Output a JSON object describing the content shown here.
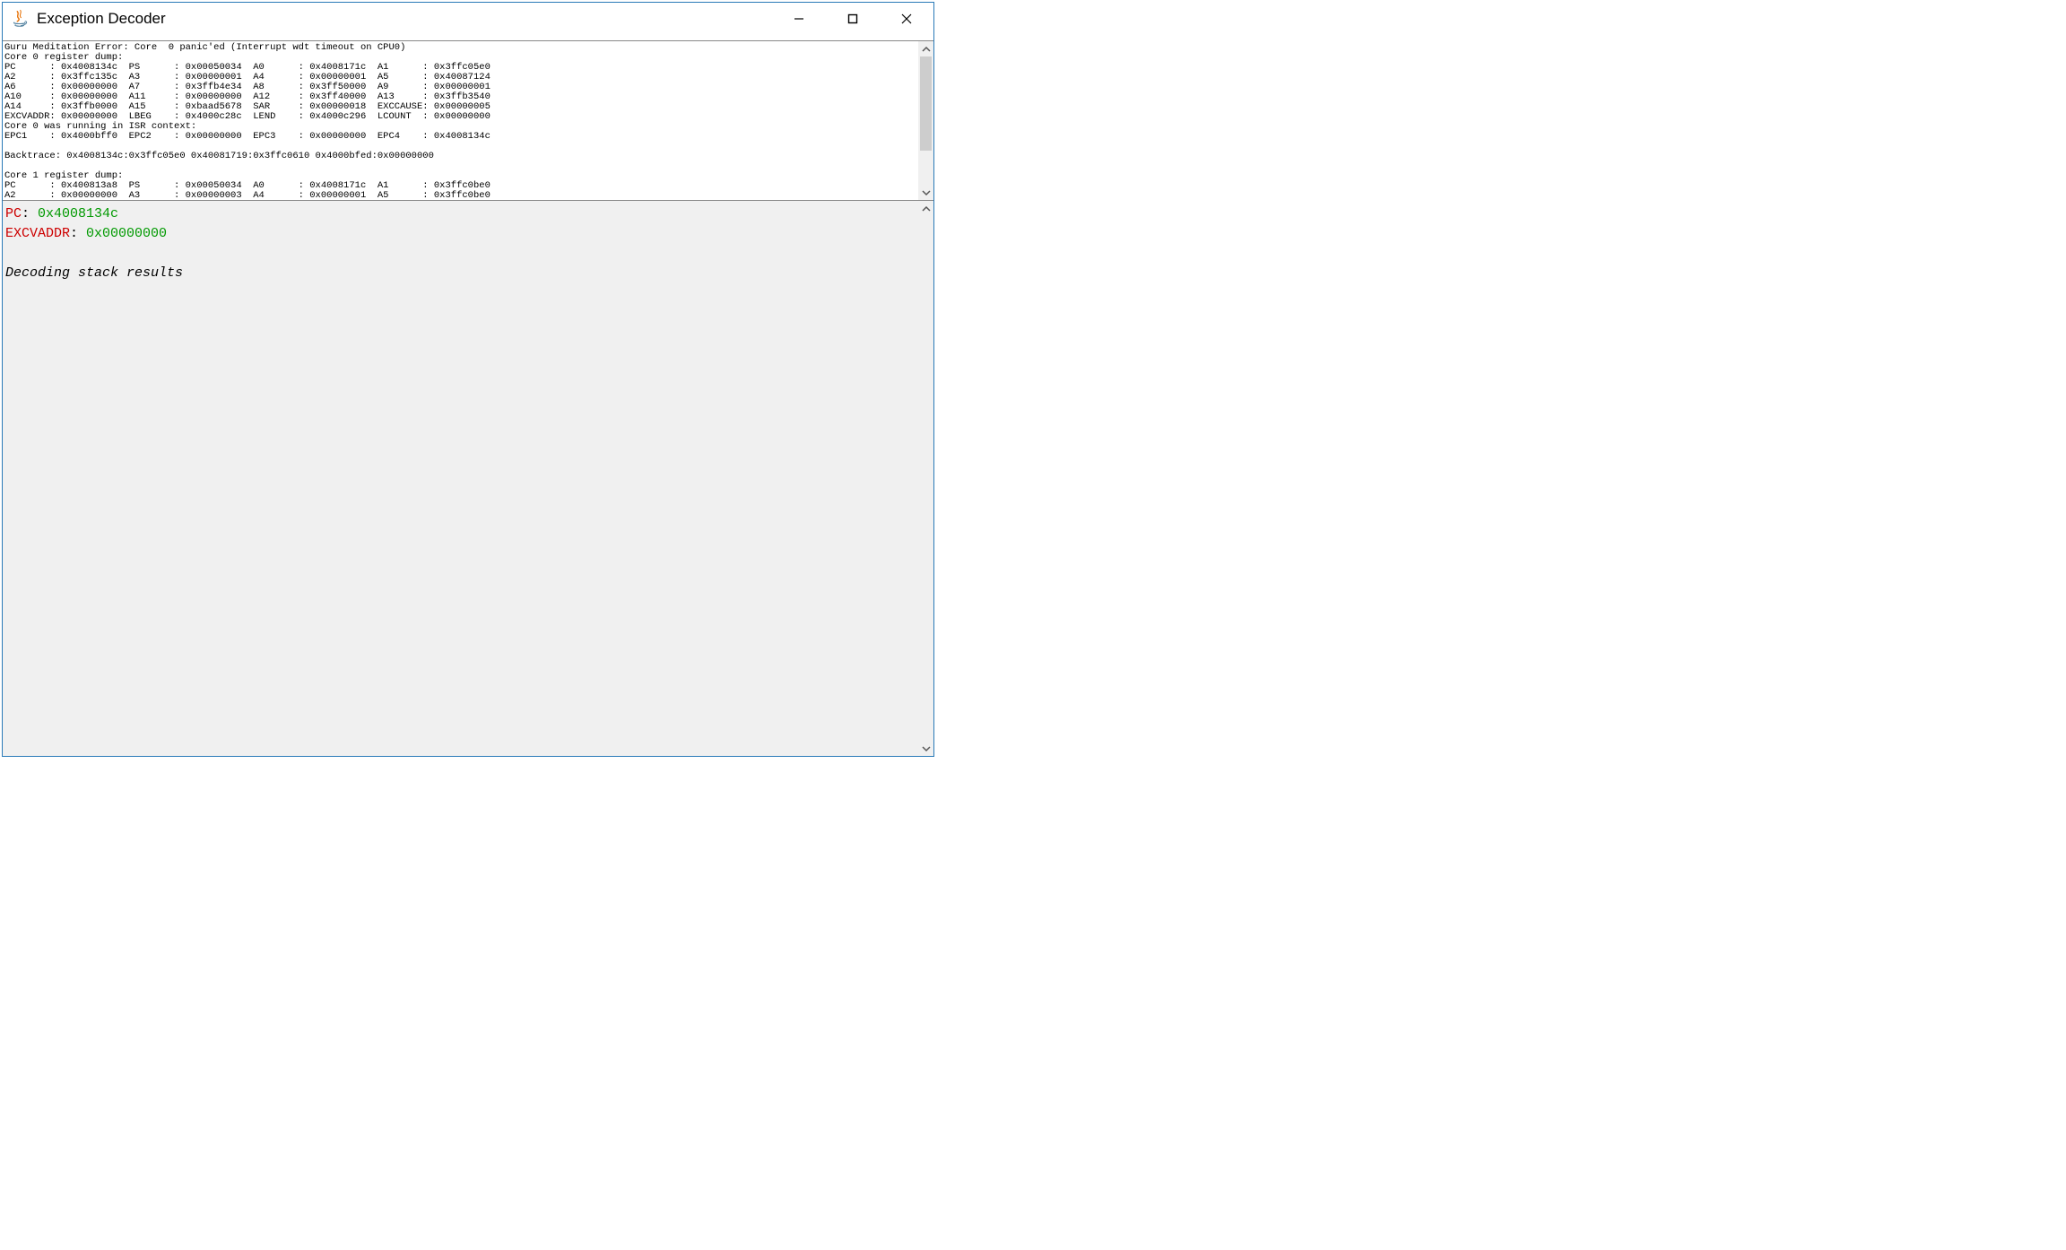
{
  "window": {
    "title": "Exception Decoder"
  },
  "topPane": {
    "text": "Guru Meditation Error: Core  0 panic'ed (Interrupt wdt timeout on CPU0)\nCore 0 register dump:\nPC      : 0x4008134c  PS      : 0x00050034  A0      : 0x4008171c  A1      : 0x3ffc05e0  \nA2      : 0x3ffc135c  A3      : 0x00000001  A4      : 0x00000001  A5      : 0x40087124  \nA6      : 0x00000000  A7      : 0x3ffb4e34  A8      : 0x3ff50000  A9      : 0x00000001  \nA10     : 0x00000000  A11     : 0x00000000  A12     : 0x3ff40000  A13     : 0x3ffb3540  \nA14     : 0x3ffb0000  A15     : 0xbaad5678  SAR     : 0x00000018  EXCCAUSE: 0x00000005  \nEXCVADDR: 0x00000000  LBEG    : 0x4000c28c  LEND    : 0x4000c296  LCOUNT  : 0x00000000  \nCore 0 was running in ISR context:\nEPC1    : 0x4000bff0  EPC2    : 0x00000000  EPC3    : 0x00000000  EPC4    : 0x4008134c\n\nBacktrace: 0x4008134c:0x3ffc05e0 0x40081719:0x3ffc0610 0x4000bfed:0x00000000\n\nCore 1 register dump:\nPC      : 0x400813a8  PS      : 0x00050034  A0      : 0x4008171c  A1      : 0x3ffc0be0  \nA2      : 0x00000000  A3      : 0x00000003  A4      : 0x00000001  A5      : 0x3ffc0be0  "
  },
  "bottomPane": {
    "pcLabel": "PC",
    "pcColon": ": ",
    "pcValue": "0x4008134c",
    "excvLabel": "EXCVADDR",
    "excvColon": ": ",
    "excvValue": "0x00000000",
    "decoding": "Decoding stack results"
  }
}
